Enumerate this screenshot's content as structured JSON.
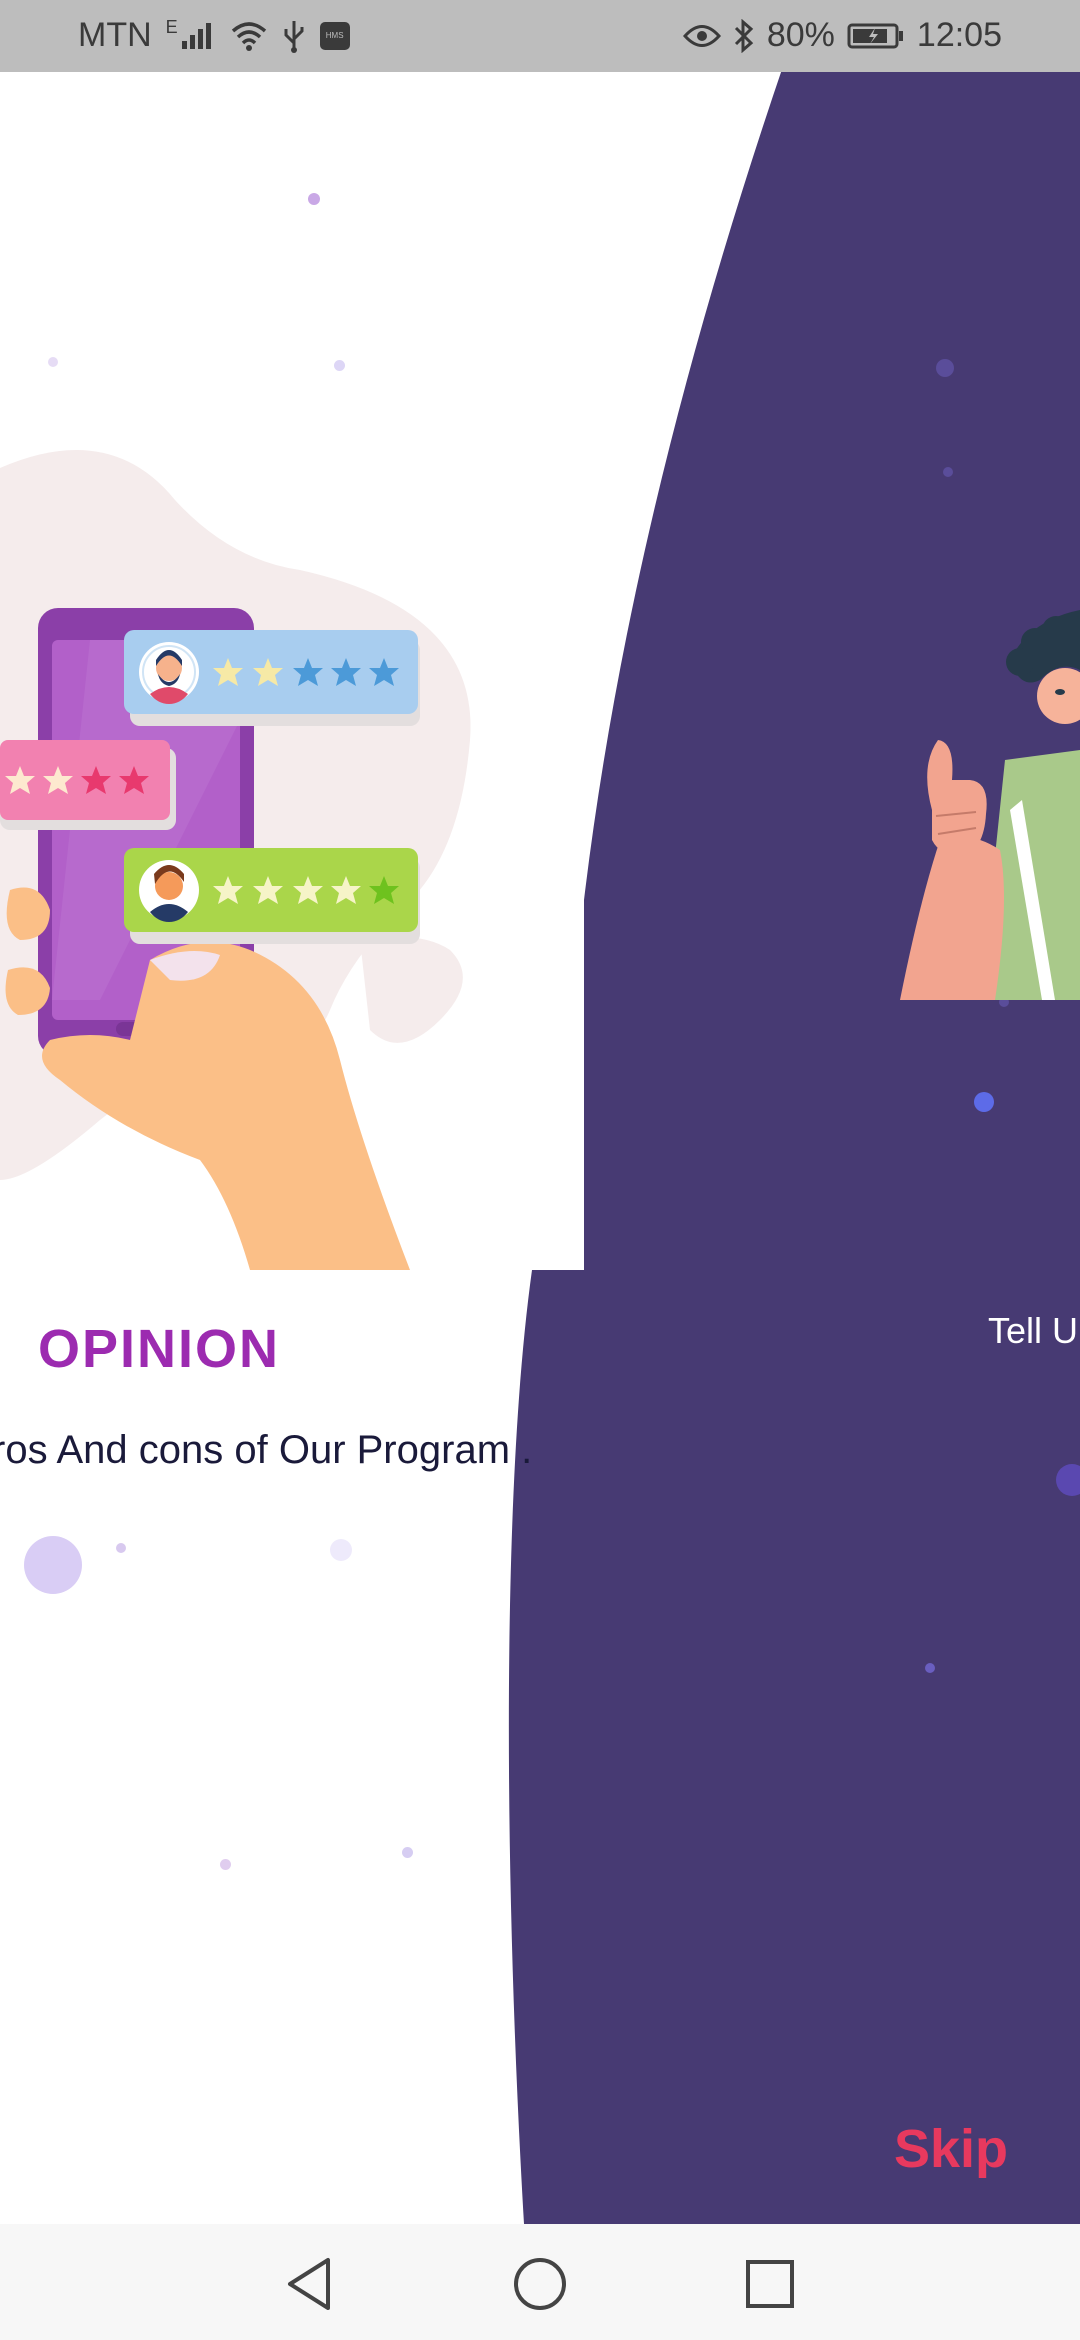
{
  "status_bar": {
    "carrier": "MTN",
    "network_type": "E",
    "battery_percent": "80%",
    "time": "12:05",
    "icons": [
      "signal-icon",
      "wifi-icon",
      "usb-icon",
      "hms-icon",
      "eye-icon",
      "bluetooth-icon",
      "battery-icon"
    ],
    "hms_label": "HMS"
  },
  "onboarding": {
    "title": "OPINION",
    "subtitle": "ros And cons of Our Program .",
    "next_slide_text": "Tell U",
    "skip_label": "Skip"
  },
  "navigation": {
    "back_icon": "back-icon",
    "home_icon": "home-icon",
    "recents_icon": "recents-icon"
  },
  "colors": {
    "panel": "#473a73",
    "title": "#9c2bb0",
    "skip": "#e8395e",
    "status_bar": "#bdbdbd"
  }
}
